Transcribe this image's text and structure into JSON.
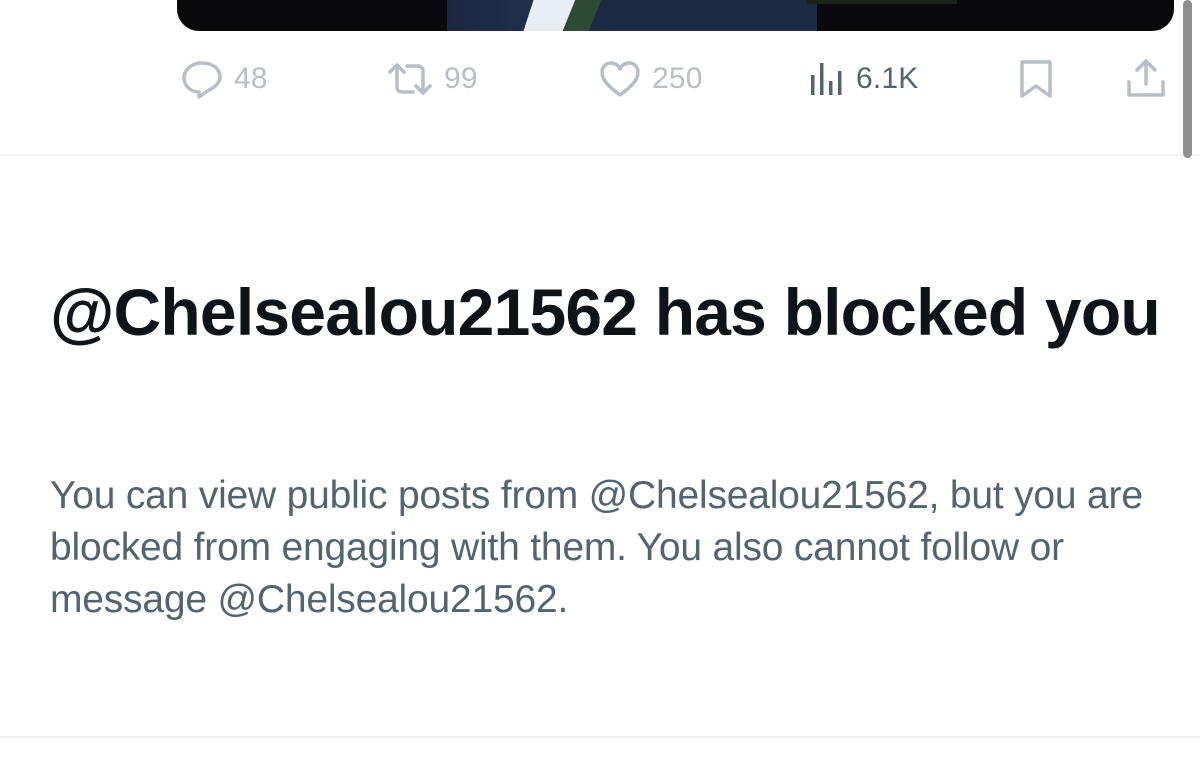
{
  "colors": {
    "primary_text": "#0f1419",
    "secondary_text": "#536471",
    "icon_muted": "#b7bec5",
    "divider": "#eff3f4"
  },
  "actions": {
    "reply": {
      "icon": "reply-bubble-icon",
      "count": "48"
    },
    "repost": {
      "icon": "repost-icon",
      "count": "99"
    },
    "like": {
      "icon": "heart-icon",
      "count": "250"
    },
    "views": {
      "icon": "views-chart-icon",
      "count": "6.1K"
    },
    "bookmark": {
      "icon": "bookmark-icon"
    },
    "share": {
      "icon": "share-icon"
    }
  },
  "block_notice": {
    "title": "@Chelsealou21562 has blocked you",
    "body": "You can view public posts from @Chelsealou21562, but you are blocked from engaging with them. You also cannot follow or message @Chelsealou21562."
  }
}
